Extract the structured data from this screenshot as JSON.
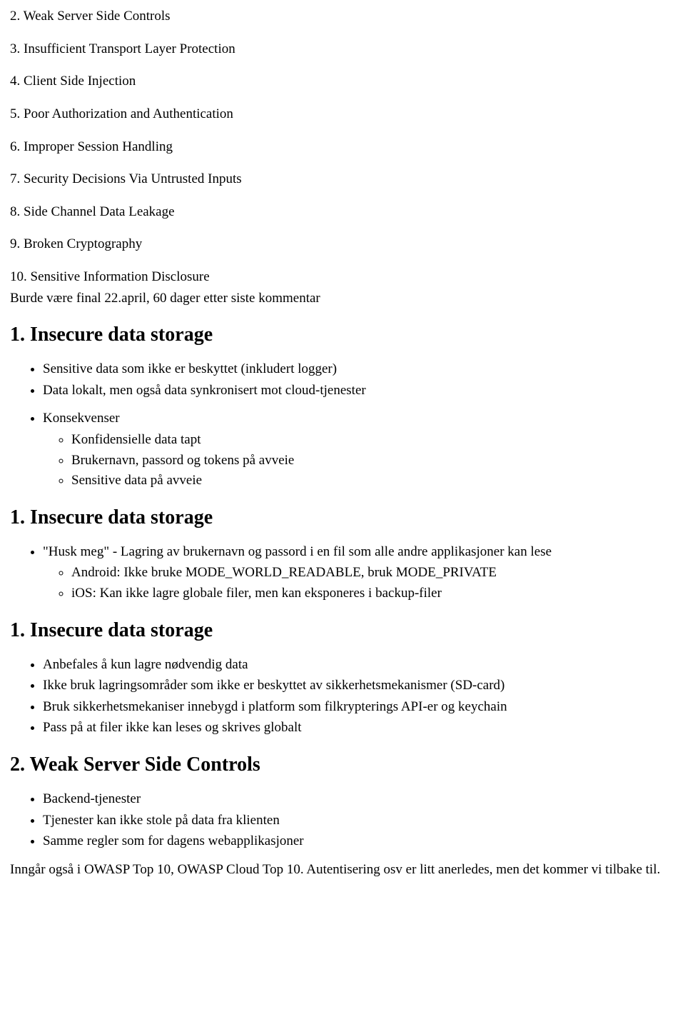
{
  "ordered_list": {
    "start": 2,
    "items": [
      "Weak Server Side Controls",
      "Insufficient Transport Layer Protection",
      "Client Side Injection",
      "Poor Authorization and Authentication",
      "Improper Session Handling",
      "Security Decisions Via Untrusted Inputs",
      "Side Channel Data Leakage",
      "Broken Cryptography",
      "Sensitive Information Disclosure"
    ]
  },
  "note_para": "Burde være final 22.april, 60 dager etter siste kommentar",
  "section_a": {
    "heading": "1. Insecure data storage",
    "bullets": [
      "Sensitive data som ikke er beskyttet (inkludert logger)",
      "Data lokalt, men også data synkronisert mot cloud-tjenester"
    ],
    "subgroup": {
      "label": "Konsekvenser",
      "items": [
        "Konfidensielle data tapt",
        "Brukernavn, passord og tokens på avveie",
        "Sensitive data på avveie"
      ]
    }
  },
  "section_b": {
    "heading": "1. Insecure data storage",
    "bullets": [
      {
        "text": "\"Husk meg\" - Lagring av brukernavn og passord i en fil som alle andre applikasjoner kan lese",
        "sub": [
          "Android: Ikke bruke MODE_WORLD_READABLE, bruk MODE_PRIVATE",
          "iOS: Kan ikke lagre globale filer, men kan eksponeres i backup-filer"
        ]
      }
    ]
  },
  "section_c": {
    "heading": "1. Insecure data storage",
    "bullets": [
      "Anbefales å kun lagre nødvendig data",
      "Ikke bruk lagringsområder som ikke er beskyttet av sikkerhetsmekanismer (SD-card)",
      "Bruk sikkerhetsmekaniser innebygd i platform som filkrypterings API-er og keychain",
      "Pass på at filer ikke kan leses og skrives globalt"
    ]
  },
  "section_d": {
    "heading": "2. Weak Server Side Controls",
    "bullets": [
      "Backend-tjenester",
      "Tjenester kan ikke stole på data fra klienten",
      "Samme regler som for dagens webapplikasjoner"
    ]
  },
  "closing_para": "Inngår også i OWASP Top 10, OWASP Cloud Top 10. Autentisering osv er litt anerledes, men det kommer vi tilbake til."
}
